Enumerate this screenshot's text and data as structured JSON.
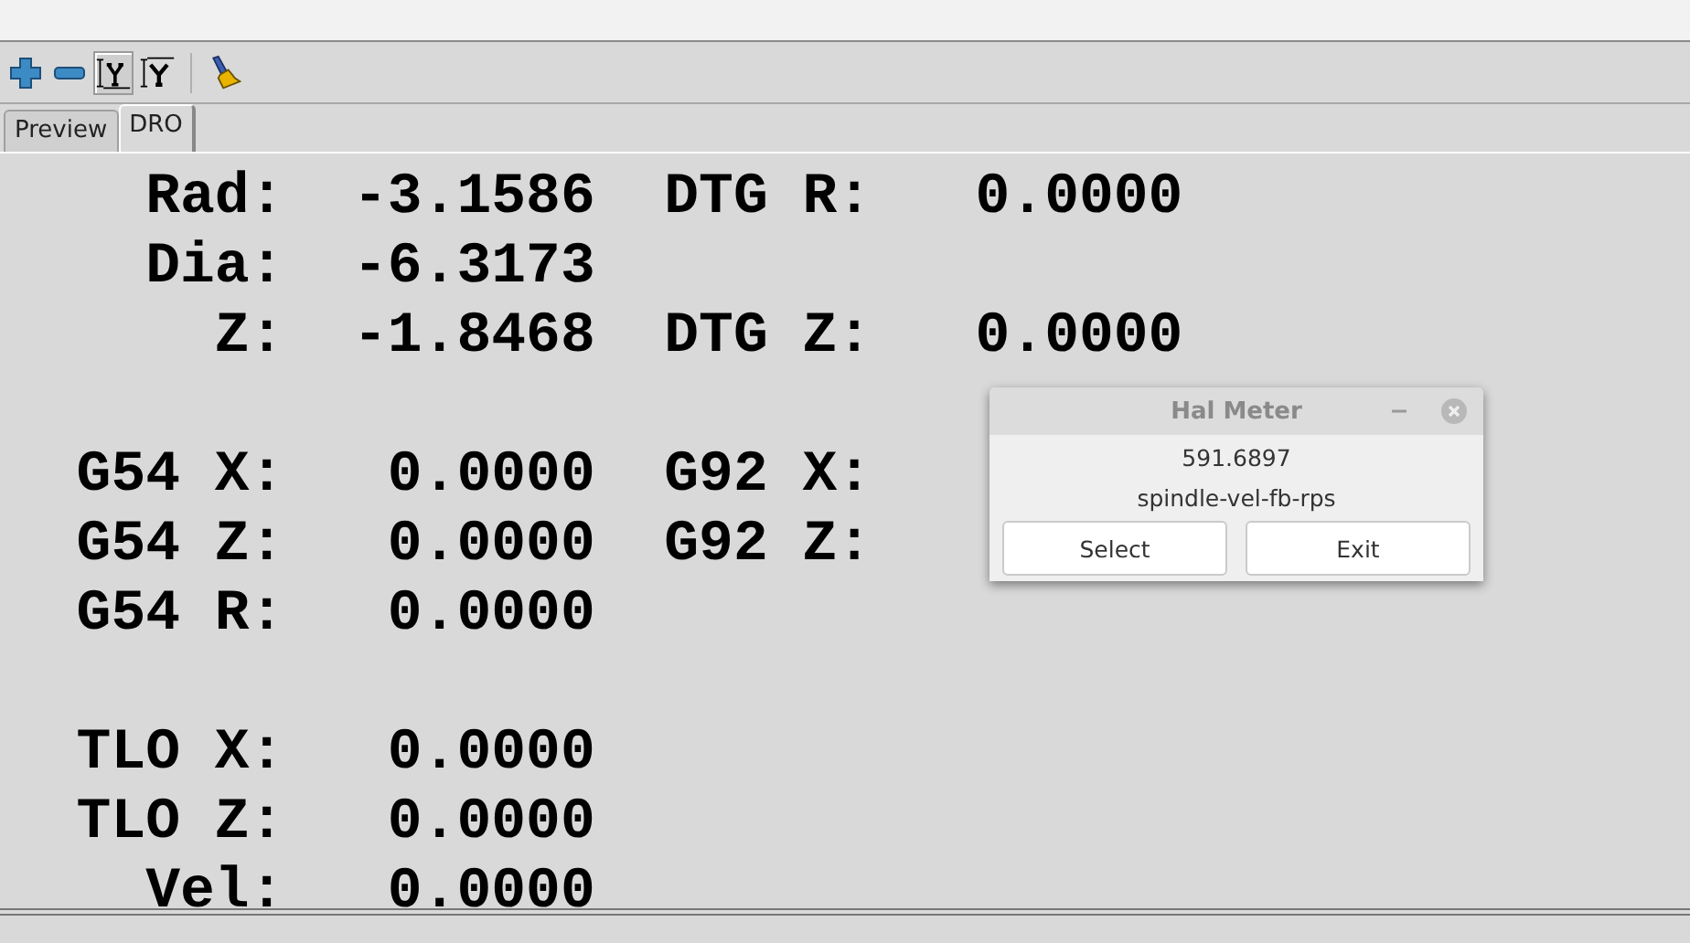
{
  "toolbar": [
    [
      {
        "kind": "zoom-in",
        "pressed": false
      },
      {
        "kind": "zoom-out",
        "pressed": false
      },
      {
        "kind": "view-y",
        "pressed": true
      },
      {
        "kind": "view-y2",
        "pressed": false
      }
    ],
    [
      {
        "kind": "clear",
        "pressed": false
      }
    ]
  ],
  "tabs": [
    {
      "label": "Preview",
      "selected": false
    },
    {
      "label": "DRO",
      "selected": true
    }
  ],
  "dro": [
    {
      "lines": [
        "    Rad:  -3.1586  DTG R:   0.0000",
        "    Dia:  -6.3173",
        "      Z:  -1.8468  DTG Z:   0.0000"
      ]
    },
    {
      "lines": [
        "  G54 X:   0.0000  G92 X:",
        "  G54 Z:   0.0000  G92 Z:",
        "  G54 R:   0.0000"
      ]
    },
    {
      "lines": [
        "  TLO X:   0.0000",
        "  TLO Z:   0.0000",
        "    Vel:   0.0000"
      ]
    }
  ],
  "hal_meter": {
    "title": "Hal Meter",
    "value": "591.6897",
    "pin": "spindle-vel-fb-rps",
    "buttons": [
      "Select",
      "Exit"
    ]
  }
}
